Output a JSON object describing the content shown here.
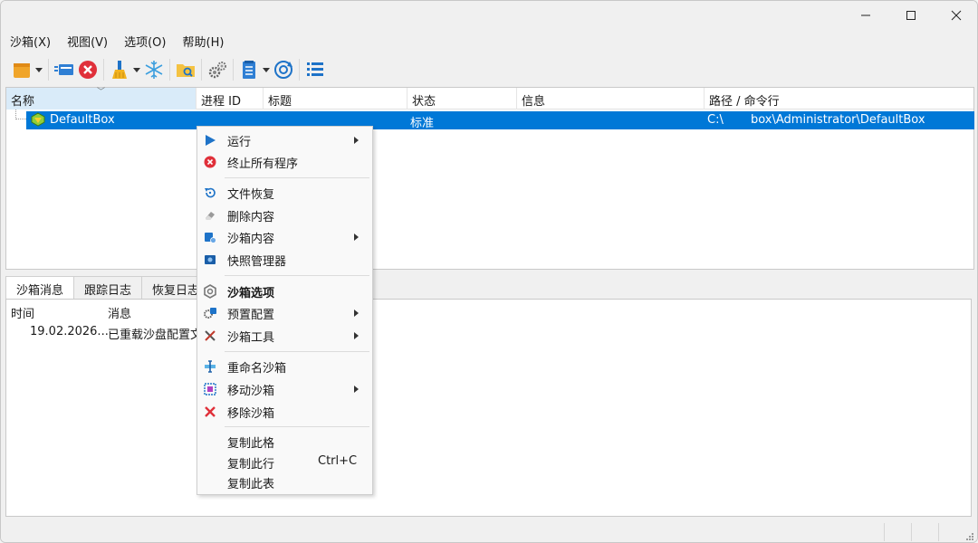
{
  "window": {
    "controls": {
      "minimize": "—",
      "maximize": "☐",
      "close": "✕"
    }
  },
  "menubar": {
    "items": [
      "沙箱(X)",
      "视图(V)",
      "选项(O)",
      "帮助(H)"
    ]
  },
  "toolbar": {
    "icons": [
      "new-box-icon",
      "show-window-icon",
      "terminate-all-icon",
      "cleanup-icon",
      "freeze-icon",
      "explore-icon",
      "settings-icon",
      "log-icon",
      "refresh-icon",
      "list-view-icon"
    ]
  },
  "listview": {
    "columns": [
      "名称",
      "进程 ID",
      "标题",
      "状态",
      "信息",
      "路径 / 命令行"
    ],
    "rows": [
      {
        "name": "DefaultBox",
        "pid": "",
        "title": "",
        "status": "标准",
        "info": "",
        "path_prefix": "C:\\",
        "path": "box\\Administrator\\DefaultBox"
      }
    ]
  },
  "bottom": {
    "tabs": [
      "沙箱消息",
      "跟踪日志",
      "恢复日志"
    ],
    "columns": [
      "时间",
      "消息"
    ],
    "rows": [
      {
        "time": "19.02.2026...",
        "message": "已重载沙盘配置文"
      }
    ]
  },
  "context_menu": {
    "items": [
      {
        "label": "运行",
        "icon": "run-icon",
        "submenu": true
      },
      {
        "label": "终止所有程序",
        "icon": "terminate-icon",
        "submenu": false
      },
      {
        "label": "文件恢复",
        "icon": "recover-icon",
        "submenu": false
      },
      {
        "label": "删除内容",
        "icon": "eraser-icon",
        "submenu": false
      },
      {
        "label": "沙箱内容",
        "icon": "box-content-icon",
        "submenu": true
      },
      {
        "label": "快照管理器",
        "icon": "snapshot-icon",
        "submenu": false
      },
      {
        "label": "沙箱选项",
        "icon": "options-icon",
        "submenu": false,
        "bold": true
      },
      {
        "label": "预置配置",
        "icon": "preset-icon",
        "submenu": true
      },
      {
        "label": "沙箱工具",
        "icon": "tools-icon",
        "submenu": true
      },
      {
        "label": "重命名沙箱",
        "icon": "rename-icon",
        "submenu": false
      },
      {
        "label": "移动沙箱",
        "icon": "move-icon",
        "submenu": true
      },
      {
        "label": "移除沙箱",
        "icon": "remove-icon",
        "submenu": false
      },
      {
        "label": "复制此格",
        "icon": "",
        "submenu": false
      },
      {
        "label": "复制此行",
        "icon": "",
        "submenu": false,
        "shortcut": "Ctrl+C"
      },
      {
        "label": "复制此表",
        "icon": "",
        "submenu": false
      }
    ]
  },
  "colors": {
    "selection": "#0078d7",
    "accent_blue": "#1e73c8",
    "danger_red": "#e0303a"
  }
}
